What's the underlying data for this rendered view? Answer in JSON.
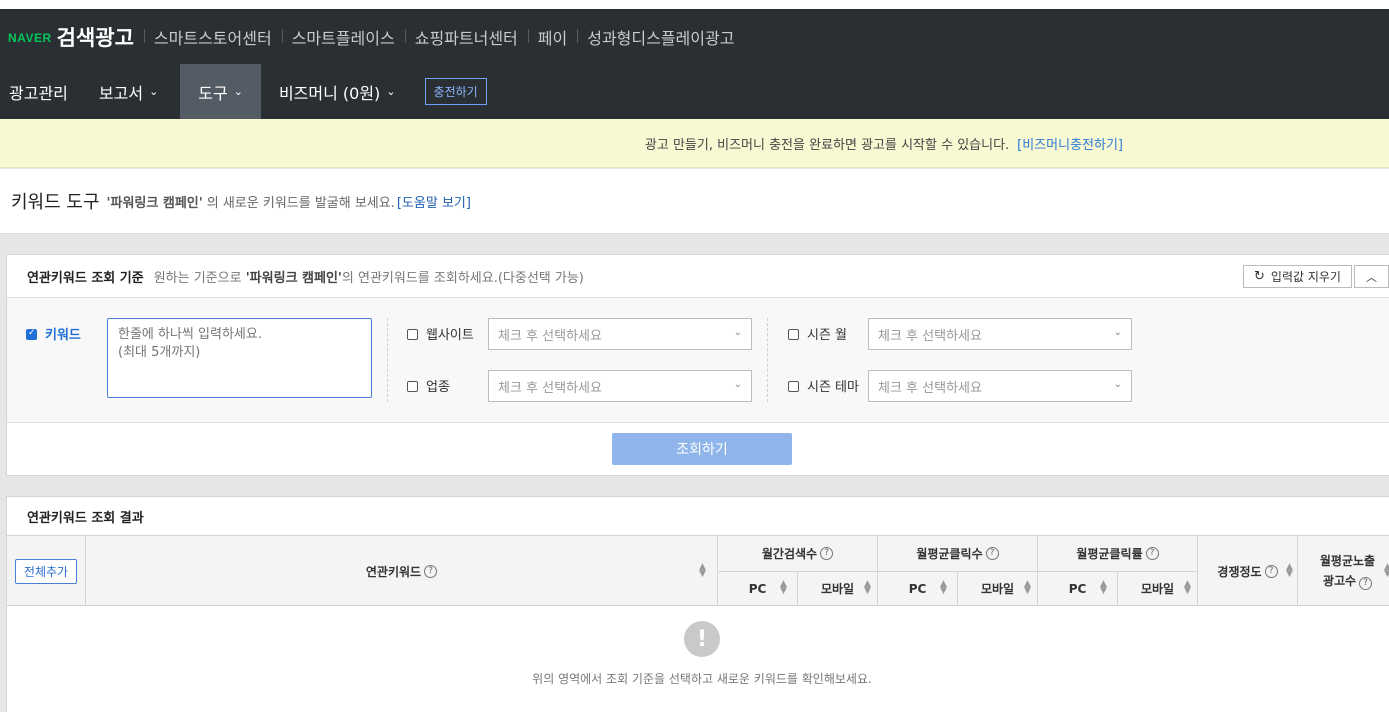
{
  "gnb": {
    "brand": "NAVER",
    "title": "검색광고",
    "links": [
      "스마트스토어센터",
      "스마트플레이스",
      "쇼핑파트너센터",
      "페이",
      "성과형디스플레이광고"
    ]
  },
  "lnb": {
    "items": [
      "광고관리",
      "보고서",
      "도구",
      "비즈머니 (0원)"
    ],
    "charge": "충전하기"
  },
  "notice": {
    "text": "광고 만들기, 비즈머니 충전을 완료하면 광고를 시작할 수 있습니다.",
    "link": "[비즈머니충전하기]"
  },
  "page": {
    "title": "키워드 도구",
    "campaign": "'파워링크 캠페인'",
    "desc": "의 새로운 키워드를 발굴해 보세요.",
    "help": "[도움말 보기]"
  },
  "criteria": {
    "title": "연관키워드 조회 기준",
    "desc_prefix": "원하는 기준으로 ",
    "desc_campaign": "'파워링크 캠페인'",
    "desc_suffix": "의 연관키워드를 조회하세요.(다중선택 가능)",
    "reset": "입력값 지우기",
    "keyword_label": "키워드",
    "keyword_placeholder": "한줄에 하나씩 입력하세요.\n(최대 5개까지)",
    "website_label": "웹사이트",
    "industry_label": "업종",
    "season_month_label": "시즌 월",
    "season_theme_label": "시즌 테마",
    "select_placeholder": "체크 후 선택하세요",
    "search_button": "조회하기"
  },
  "results": {
    "title": "연관키워드 조회 결과",
    "add_all": "전체추가",
    "col_keyword": "연관키워드",
    "col_monthly_search": "월간검색수",
    "col_avg_clicks": "월평균클릭수",
    "col_avg_ctr": "월평균클릭률",
    "col_competition": "경쟁정도",
    "col_avg_ads_line1": "월평균노출",
    "col_avg_ads_line2": "광고수",
    "pc": "PC",
    "mobile": "모바일",
    "empty": "위의 영역에서 조회 기준을 선택하고 새로운 키워드를 확인해보세요."
  },
  "icons": {
    "empty": "exclamation-icon",
    "help": "question-circle-icon",
    "sort": "sort-updown-icon",
    "reset": "refresh-icon"
  }
}
